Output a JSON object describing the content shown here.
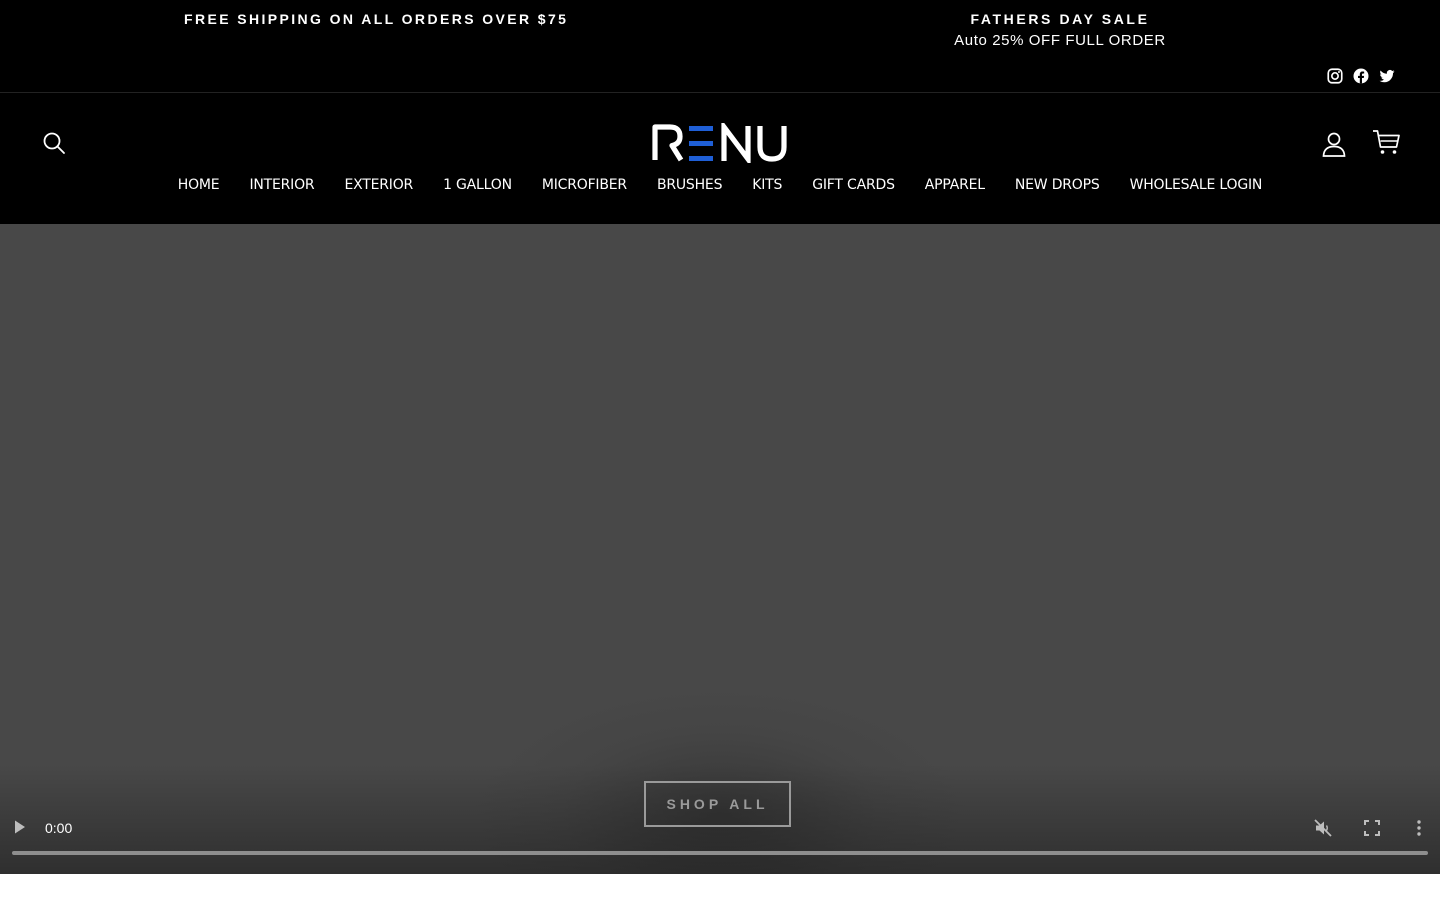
{
  "announcement": {
    "left_text": "FREE SHIPPING ON ALL ORDERS OVER $75",
    "right_title": "FATHERS DAY SALE",
    "right_subtitle": "Auto 25% OFF FULL ORDER",
    "social": [
      {
        "name": "instagram-icon"
      },
      {
        "name": "facebook-icon"
      },
      {
        "name": "twitter-icon"
      }
    ]
  },
  "header": {
    "logo_text": "RENU",
    "icons": [
      "search-icon",
      "account-icon",
      "cart-icon"
    ]
  },
  "nav": {
    "items": [
      {
        "label": "HOME"
      },
      {
        "label": "INTERIOR"
      },
      {
        "label": "EXTERIOR"
      },
      {
        "label": "1 GALLON"
      },
      {
        "label": "MICROFIBER"
      },
      {
        "label": "BRUSHES"
      },
      {
        "label": "KITS"
      },
      {
        "label": "GIFT CARDS"
      },
      {
        "label": "APPAREL"
      },
      {
        "label": "NEW DROPS"
      },
      {
        "label": "WHOLESALE LOGIN"
      }
    ]
  },
  "hero": {
    "cta_label": "SHOP ALL",
    "video": {
      "current_time": "0:00",
      "progress_fraction": 0,
      "muted": true
    }
  },
  "colors": {
    "background": "#000000",
    "logo_accent": "#1f5fd6",
    "video_bg": "#484848"
  }
}
